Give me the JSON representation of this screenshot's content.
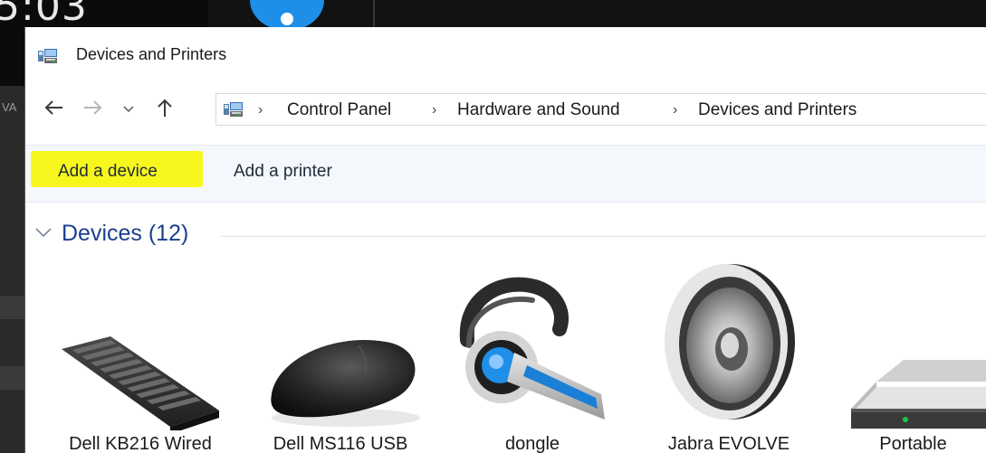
{
  "background": {
    "clock_text": "5:03",
    "side_text": "VA"
  },
  "window": {
    "title": "Devices and Printers",
    "title_icon": "devices-and-printers-icon"
  },
  "navigation": {
    "back_icon": "arrow-left-icon",
    "forward_icon": "arrow-right-icon",
    "recent_icon": "chevron-down-icon",
    "up_icon": "arrow-up-icon",
    "breadcrumb": [
      "Control Panel",
      "Hardware and Sound",
      "Devices and Printers"
    ]
  },
  "commands": {
    "add_device": "Add a device",
    "add_printer": "Add a printer"
  },
  "devices_group": {
    "title": "Devices (12)",
    "items": [
      {
        "label": "Dell KB216 Wired",
        "icon": "keyboard-icon"
      },
      {
        "label": "Dell MS116 USB",
        "icon": "mouse-icon"
      },
      {
        "label": "dongle",
        "icon": "headset-icon"
      },
      {
        "label": "Jabra EVOLVE",
        "icon": "speaker-icon"
      },
      {
        "label": "Portable",
        "icon": "portable-drive-icon"
      }
    ]
  },
  "colors": {
    "highlight": "#f7f71d",
    "group_title": "#1b3f8f",
    "command_bar_bg": "#f4f7fc",
    "accent_blue": "#1e8fe8"
  }
}
